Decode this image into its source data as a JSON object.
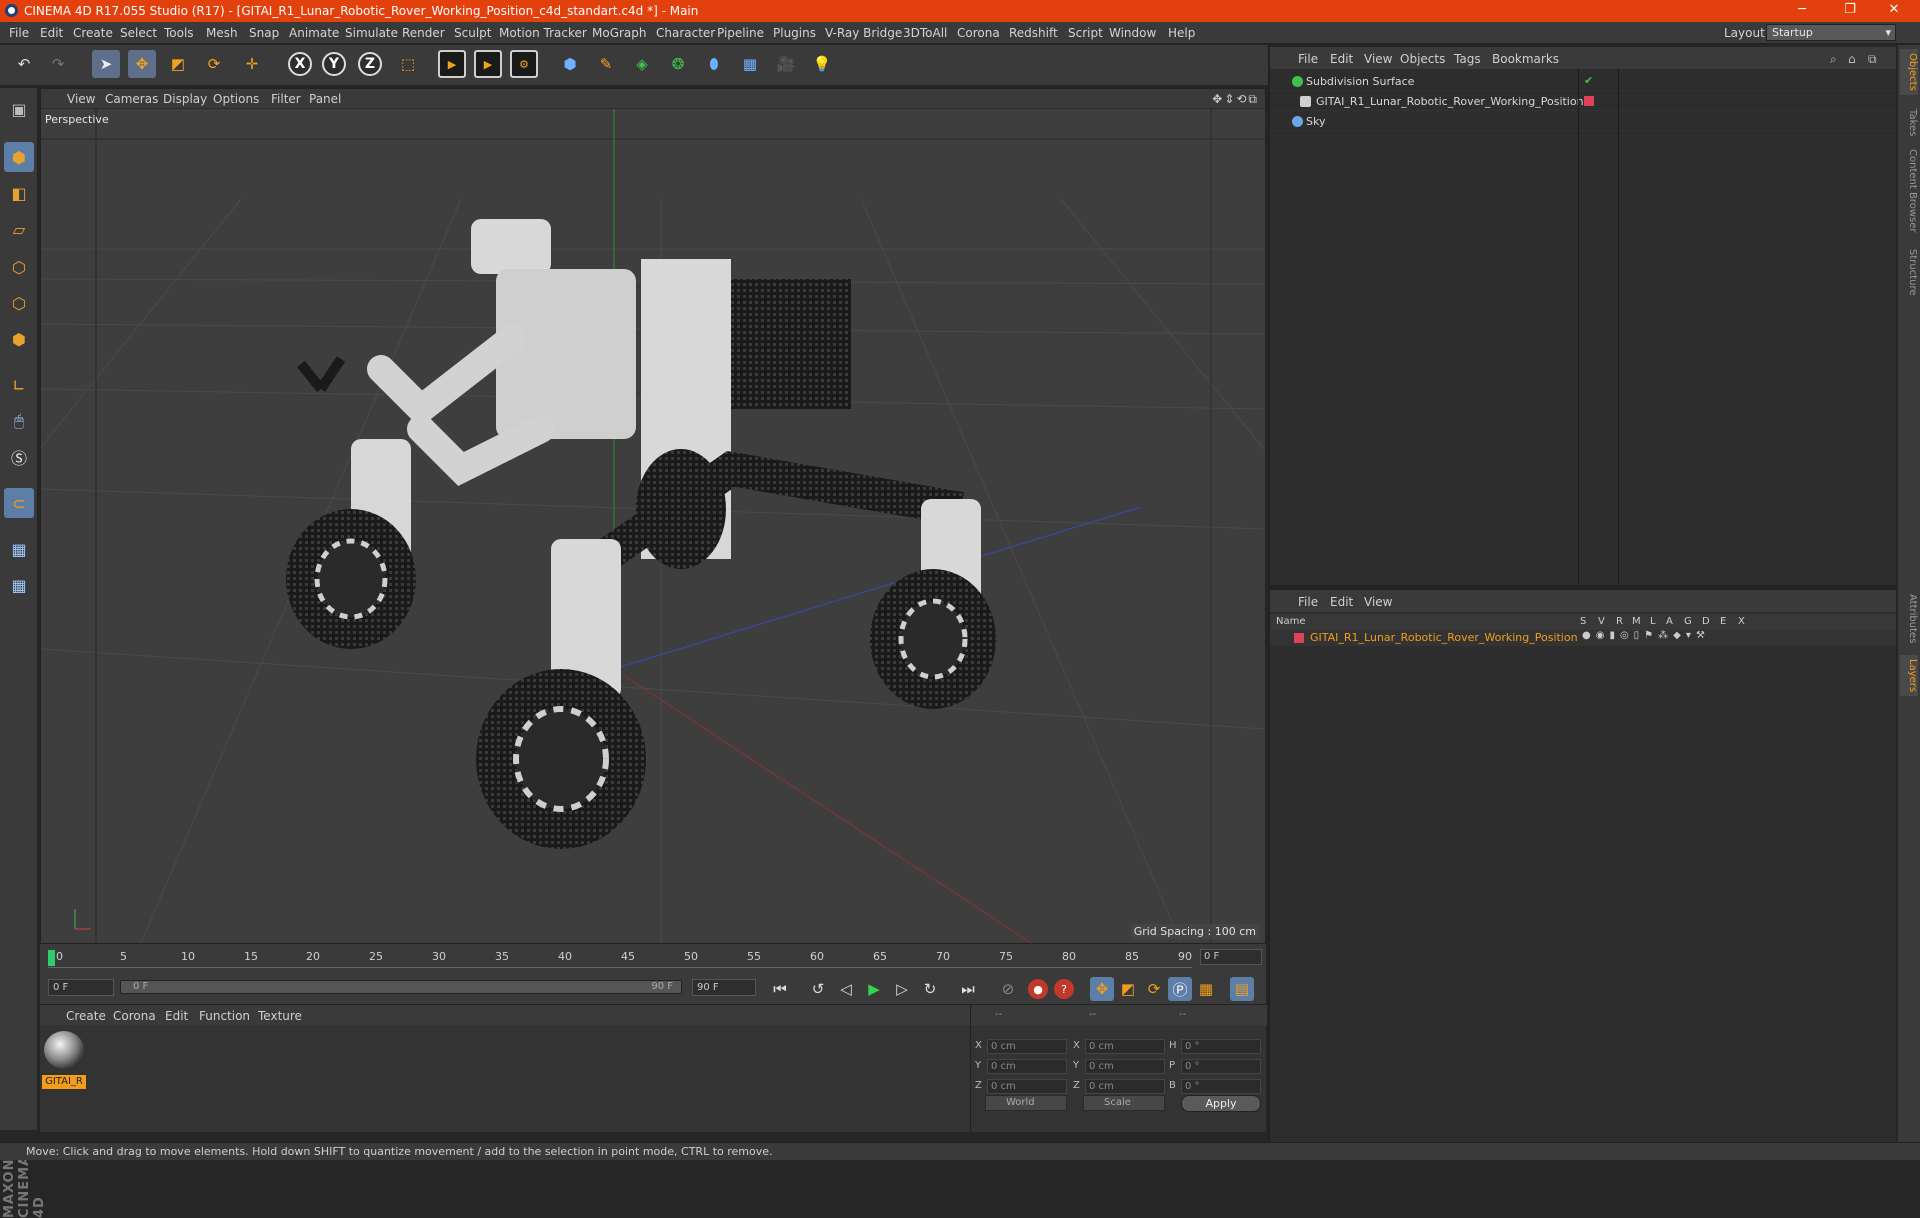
{
  "titlebar": {
    "title": "CINEMA 4D R17.055 Studio (R17) - [GITAI_R1_Lunar_Robotic_Rover_Working_Position_c4d_standart.c4d *] - Main",
    "minimize": "─",
    "restore": "❐",
    "close": "✕"
  },
  "menubar": {
    "items": [
      "File",
      "Edit",
      "Create",
      "Select",
      "Tools",
      "Mesh",
      "Snap",
      "Animate",
      "Simulate",
      "Render",
      "Sculpt",
      "Motion Tracker",
      "MoGraph",
      "Character",
      "Pipeline",
      "Plugins",
      "V-Ray Bridge",
      "3DToAll",
      "Corona",
      "Redshift",
      "Script",
      "Window",
      "Help"
    ],
    "layout_label": "Layout:",
    "layout_value": "Startup"
  },
  "viewport": {
    "menu": [
      "View",
      "Cameras",
      "Display",
      "Options",
      "Filter",
      "Panel"
    ],
    "label": "Perspective",
    "grid_spacing": "Grid Spacing : 100 cm"
  },
  "timeline": {
    "ticks": [
      "0",
      "5",
      "10",
      "15",
      "20",
      "25",
      "30",
      "35",
      "40",
      "45",
      "50",
      "55",
      "60",
      "65",
      "70",
      "75",
      "80",
      "85",
      "90"
    ],
    "current_frame": "0 F"
  },
  "transport": {
    "start_field": "0 F",
    "range_start": "0 F",
    "range_end": "90 F",
    "end_field": "90 F"
  },
  "material_manager": {
    "menu": [
      "Create",
      "Corona",
      "Edit",
      "Function",
      "Texture"
    ],
    "material_name": "GITAI_R"
  },
  "coordinates": {
    "head": [
      "--",
      "--",
      "--"
    ],
    "rows": [
      {
        "axis": "X",
        "pos": "0 cm",
        "axis2": "X",
        "size": "0 cm",
        "axis3": "H",
        "rot": "0 °"
      },
      {
        "axis": "Y",
        "pos": "0 cm",
        "axis2": "Y",
        "size": "0 cm",
        "axis3": "P",
        "rot": "0 °"
      },
      {
        "axis": "Z",
        "pos": "0 cm",
        "axis2": "Z",
        "size": "0 cm",
        "axis3": "B",
        "rot": "0 °"
      }
    ],
    "space": "World",
    "mode": "Scale",
    "apply": "Apply"
  },
  "object_manager": {
    "menu": [
      "File",
      "Edit",
      "View",
      "Objects",
      "Tags",
      "Bookmarks"
    ],
    "objects": [
      {
        "name": "Subdivision Surface",
        "icon_color": "#3fc24b"
      },
      {
        "name": "GITAI_R1_Lunar_Robotic_Rover_Working_Position",
        "icon_color": "#cfcfcf"
      },
      {
        "name": "Sky",
        "icon_color": "#6aa6e8"
      }
    ]
  },
  "layer_manager": {
    "menu": [
      "File",
      "Edit",
      "View"
    ],
    "columns": [
      "Name",
      "S",
      "V",
      "R",
      "M",
      "L",
      "A",
      "G",
      "D",
      "E",
      "X"
    ],
    "layer_name": "GITAI_R1_Lunar_Robotic_Rover_Working_Position",
    "layer_color": "#e0405a"
  },
  "right_tabs": [
    "Objects",
    "Takes",
    "Content Browser",
    "Structure",
    "Attributes",
    "Layers"
  ],
  "statusbar": "Move: Click and drag to move elements. Hold down SHIFT to quantize movement / add to the selection in point mode, CTRL to remove.",
  "brand_vertical": "MAXON CINEMA 4D",
  "colors": {
    "title_bar": "#e2400c",
    "accent": "#f29d1c",
    "selection": "#5d7ea6"
  }
}
